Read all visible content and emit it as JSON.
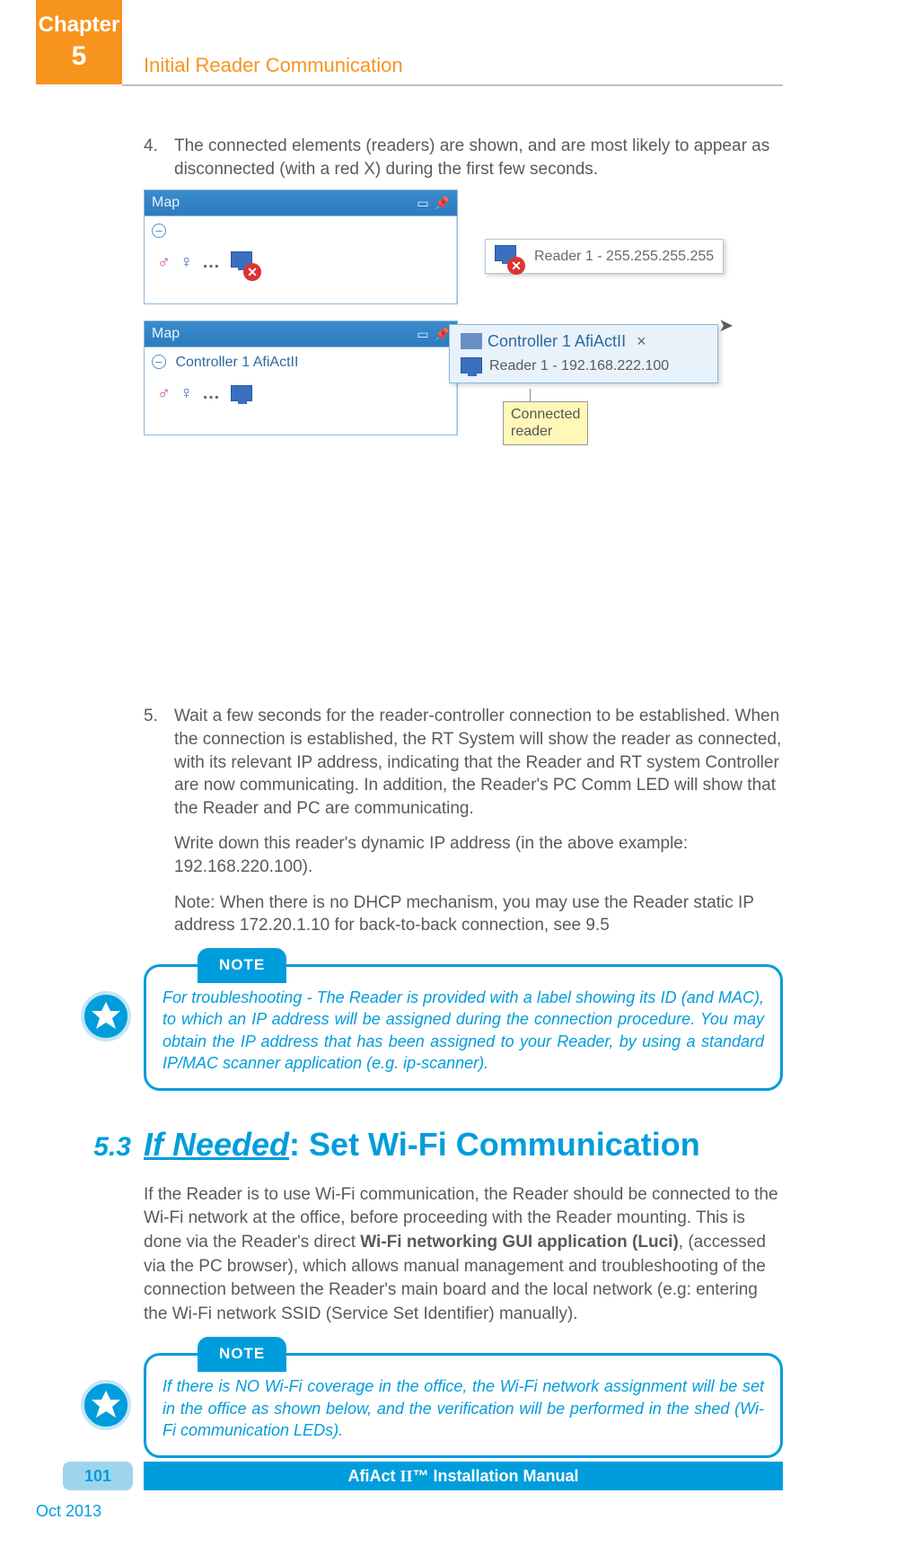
{
  "chapter": {
    "label": "Chapter",
    "number": "5"
  },
  "header": {
    "title": "Initial Reader Communication"
  },
  "items": {
    "4": {
      "num": "4.",
      "text": "The connected elements (readers) are shown, and are most likely to appear as disconnected (with a red X) during the first few seconds."
    },
    "5": {
      "num": "5.",
      "text": "Wait a few seconds for the reader-controller connection to be established. When the connection is established, the RT System will show the reader as connected, with its relevant IP address, indicating that the Reader and RT system Controller are now communicating. In addition, the Reader's PC Comm LED will show that the Reader and PC are communicating.",
      "sub1": "Write down this reader's dynamic IP address (in the above example: 192.168.220.100).",
      "sub2": "Note: When there is no DHCP mechanism, you may use the Reader static IP address 172.20.1.10 for back-to-back connection, see 9.5"
    }
  },
  "screenshot": {
    "map_title": "Map",
    "reader_disc": "Reader 1 - 255.255.255.255",
    "controller_line": "Controller 1 AfiActII",
    "controller_title": "Controller 1 AfiActII",
    "reader_conn": "Reader 1 - 192.168.222.100",
    "callout_l1": "Connected",
    "callout_l2": "reader"
  },
  "note1": {
    "label": "NOTE",
    "text": "For troubleshooting - The Reader is provided with a label showing its ID (and MAC), to which an IP address will be assigned during the connection procedure. You may obtain the IP address that has been assigned to your Reader, by using a standard IP/MAC scanner application (e.g. ip-scanner)."
  },
  "section": {
    "num": "5.3",
    "title_u": "If Needed",
    "title_rest": ": Set Wi-Fi Communication",
    "para_pre": "If the Reader is to use Wi-Fi communication, the Reader should be connected to the Wi-Fi network at the office, before proceeding with the Reader mounting. This is done via the Reader's direct ",
    "para_bold": "Wi-Fi networking GUI application (Luci)",
    "para_post": ", (accessed via the PC browser), which allows manual management and troubleshooting of the connection between the Reader's main board and the local network (e.g: entering the Wi-Fi network SSID (Service Set Identifier) manually)."
  },
  "note2": {
    "label": "NOTE",
    "text": "If there is NO Wi-Fi coverage in the office, the Wi-Fi network assignment will be set in the office as shown below, and the verification will be performed in the shed (Wi-Fi communication LEDs)."
  },
  "footer": {
    "page": "101",
    "date": "Oct 2013",
    "manual_prefix": "AfiAct ",
    "manual_roman": "II",
    "manual_suffix": "™ Installation Manual"
  }
}
